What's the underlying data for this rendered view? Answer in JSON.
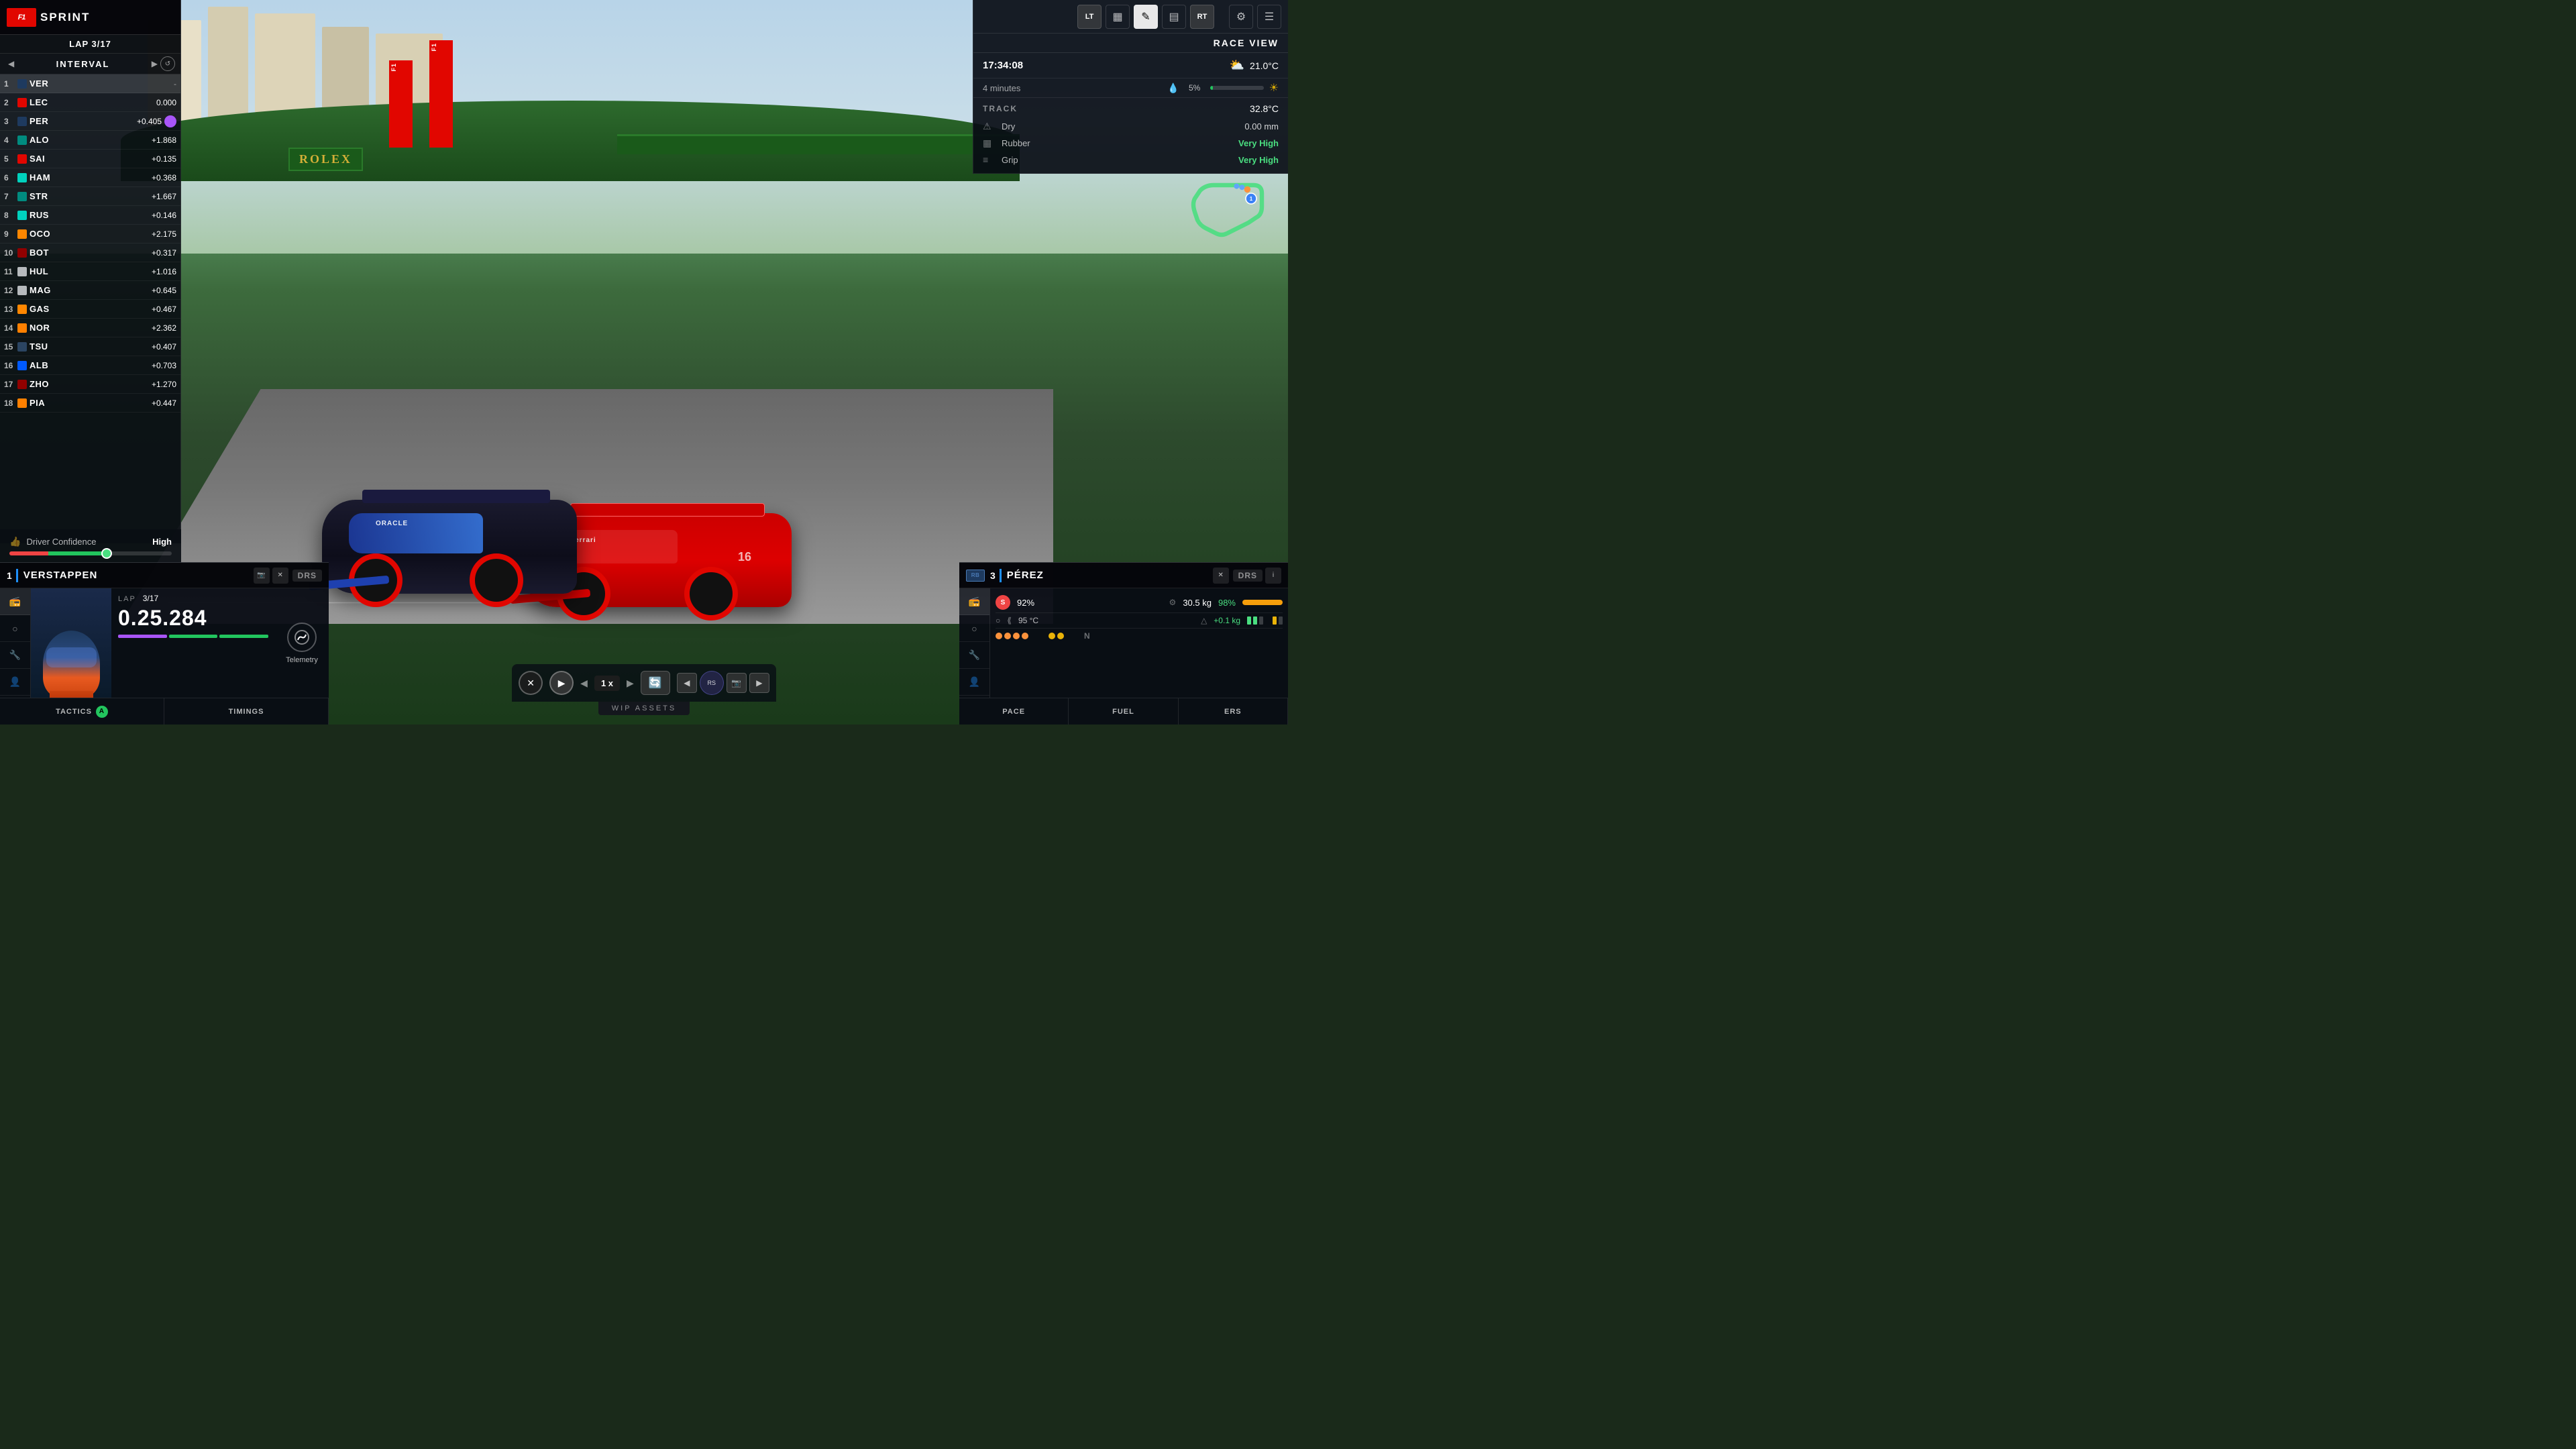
{
  "header": {
    "f1_logo": "F1",
    "sprint_label": "SPRINT",
    "lap_info": "LAP 3/17",
    "interval_label": "INTERVAL"
  },
  "standings": [
    {
      "pos": 1,
      "code": "VER",
      "gap": "-",
      "team_color": "#1e3a5f",
      "highlighted": true
    },
    {
      "pos": 2,
      "code": "LEC",
      "gap": "0.000",
      "team_color": "#e10600"
    },
    {
      "pos": 3,
      "code": "PER",
      "gap": "+0.405",
      "team_color": "#1e3a5f",
      "has_purple": true
    },
    {
      "pos": 4,
      "code": "ALO",
      "gap": "+1.868",
      "team_color": "#008b7f"
    },
    {
      "pos": 5,
      "code": "SAI",
      "gap": "+0.135",
      "team_color": "#e10600"
    },
    {
      "pos": 6,
      "code": "HAM",
      "gap": "+0.368",
      "team_color": "#00d2be"
    },
    {
      "pos": 7,
      "code": "STR",
      "gap": "+1.667",
      "team_color": "#008b7f"
    },
    {
      "pos": 8,
      "code": "RUS",
      "gap": "+0.146",
      "team_color": "#00d2be"
    },
    {
      "pos": 9,
      "code": "OCO",
      "gap": "+2.175",
      "team_color": "#ff8700"
    },
    {
      "pos": 10,
      "code": "BOT",
      "gap": "+0.317",
      "team_color": "#900000"
    },
    {
      "pos": 11,
      "code": "HUL",
      "gap": "+1.016",
      "team_color": "#b6babd"
    },
    {
      "pos": 12,
      "code": "MAG",
      "gap": "+0.645",
      "team_color": "#b6babd"
    },
    {
      "pos": 13,
      "code": "GAS",
      "gap": "+0.467",
      "team_color": "#ff8700"
    },
    {
      "pos": 14,
      "code": "NOR",
      "gap": "+2.362",
      "team_color": "#ff8000"
    },
    {
      "pos": 15,
      "code": "TSU",
      "gap": "+0.407",
      "team_color": "#2b4562"
    },
    {
      "pos": 16,
      "code": "ALB",
      "gap": "+0.703",
      "team_color": "#005aff"
    },
    {
      "pos": 17,
      "code": "ZHO",
      "gap": "+1.270",
      "team_color": "#900000"
    },
    {
      "pos": 18,
      "code": "PIA",
      "gap": "+0.447",
      "team_color": "#ff8000"
    }
  ],
  "confidence": {
    "label": "Driver Confidence",
    "value": "High"
  },
  "verstappen": {
    "pos": "1",
    "name": "VERSTAPPEN",
    "lap_label": "LAP",
    "lap_current": "3",
    "lap_total": "17",
    "lap_time": "0.25.284",
    "telemetry_label": "Telemetry",
    "tactics_label": "TACTICS",
    "timings_label": "TIMINGS",
    "a_btn": "A",
    "drs_label": "DRS"
  },
  "right_panel": {
    "race_view": "RACE VIEW",
    "time": "17:34:08",
    "air_temp": "21.0°C",
    "rain_minutes": "4 minutes",
    "rain_percent": "5%",
    "track_label": "TRACK",
    "track_temp": "32.8°C",
    "dry_label": "Dry",
    "dry_mm": "0.00 mm",
    "rubber_label": "Rubber",
    "rubber_value": "Very High",
    "grip_label": "Grip",
    "grip_value": "Very High"
  },
  "perez": {
    "pos": "3",
    "name": "PÉREZ",
    "rb_label": "RB",
    "tire_label": "S",
    "tire_pct": "92%",
    "fuel_kg": "30.5 kg",
    "fuel_pct": "98%",
    "temp_c": "95 °C",
    "fuel_change": "+0.1 kg",
    "drs_label": "DRS",
    "i_label": "i",
    "pace_label": "PACE",
    "fuel_label": "FUEL",
    "ers_label": "ERS"
  },
  "bottom_controls": {
    "speed": "1 x",
    "wip": "WIP ASSETS"
  },
  "icons": {
    "chart": "▦",
    "pencil": "✎",
    "bars": "▤",
    "gear": "⚙",
    "menu": "☰",
    "cloud": "⛅",
    "rain_drop": "💧",
    "sun": "☀",
    "warning": "⚠",
    "tire": "◎",
    "temp": "🌡",
    "rewind": "⏪",
    "play": "▶",
    "skip": "⏭",
    "camera": "📷",
    "left": "◀",
    "right": "▶",
    "prev": "←",
    "next": "→"
  },
  "track_map": {
    "car1_pos": "1",
    "accent_color": "#4ade80"
  }
}
